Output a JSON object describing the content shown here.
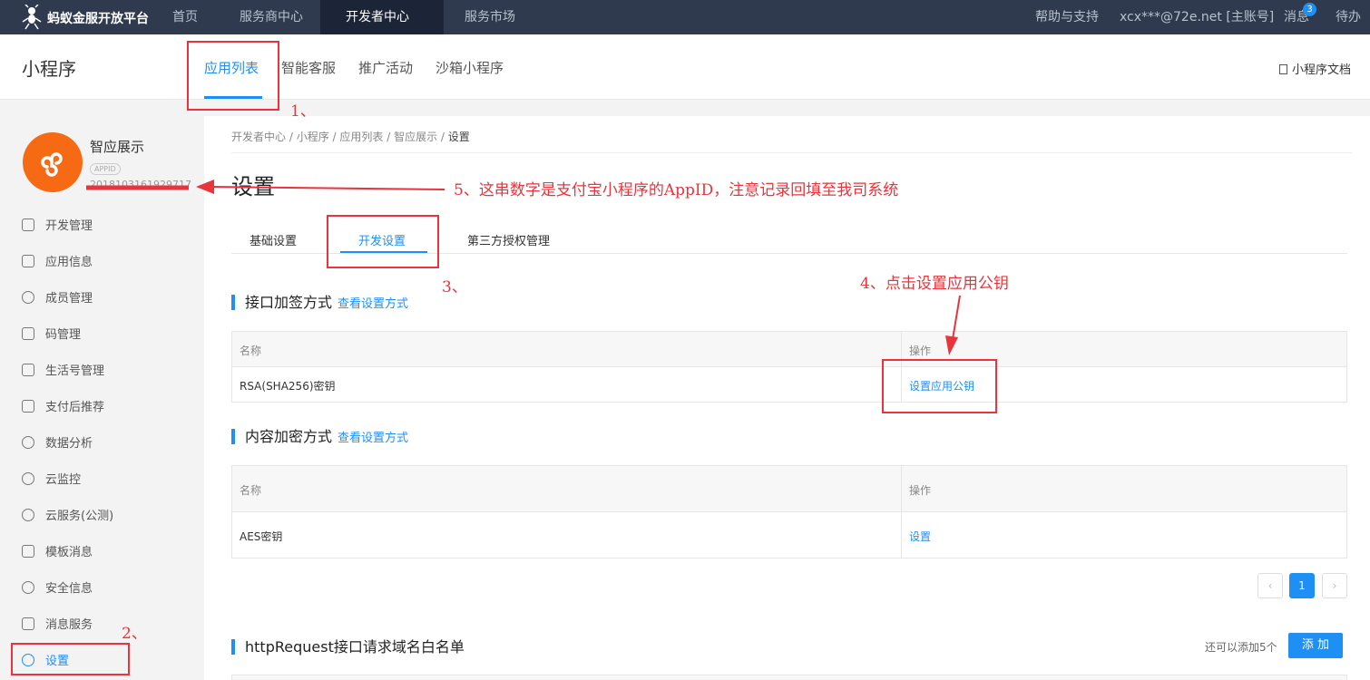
{
  "topnav": {
    "brand": "蚂蚁金服开放平台",
    "items": [
      "首页",
      "服务商中心",
      "开发者中心",
      "服务市场"
    ],
    "right": [
      "帮助与支持",
      "xcx***@72e.net [主账号]",
      "消息",
      "待办"
    ],
    "message_count": "3"
  },
  "subheader": {
    "title": "小程序",
    "tabs": [
      "应用列表",
      "智能客服",
      "推广活动",
      "沙箱小程序"
    ],
    "doc_link": "小程序文档"
  },
  "app": {
    "name": "智应展示",
    "appid_tag": "APPID",
    "appid": "2018103161929717"
  },
  "sidebar": {
    "items": [
      "开发管理",
      "应用信息",
      "成员管理",
      "码管理",
      "生活号管理",
      "支付后推荐",
      "数据分析",
      "云监控",
      "云服务(公测)",
      "模板消息",
      "安全信息",
      "消息服务",
      "设置"
    ]
  },
  "breadcrumb": [
    "开发者中心",
    "小程序",
    "应用列表",
    "智应展示",
    "设置"
  ],
  "page_title": "设置",
  "tabs": [
    "基础设置",
    "开发设置",
    "第三方授权管理"
  ],
  "section1": {
    "title": "接口加签方式",
    "link": "查看设置方式",
    "headers": [
      "名称",
      "操作"
    ],
    "row": {
      "name": "RSA(SHA256)密钥",
      "action": "设置应用公钥"
    }
  },
  "section2": {
    "title": "内容加密方式",
    "link": "查看设置方式",
    "headers": [
      "名称",
      "操作"
    ],
    "row": {
      "name": "AES密钥",
      "action": "设置"
    }
  },
  "pagination": {
    "prev": "‹",
    "current": "1",
    "next": "›"
  },
  "section3": {
    "title": "httpRequest接口请求域名白名单",
    "hint": "还可以添加5个",
    "add_button": "添 加"
  },
  "annotations": {
    "note1": "1、",
    "note2": "2、",
    "note3": "3、",
    "note4": "4、点击设置应用公钥",
    "note5": "5、这串数字是支付宝小程序的AppID，注意记录回填至我司系统"
  },
  "colors": {
    "accent": "#1e8ff3",
    "annotation": "#e8343a",
    "nav_bg": "#2f3a4f",
    "avatar": "#f56a12"
  }
}
